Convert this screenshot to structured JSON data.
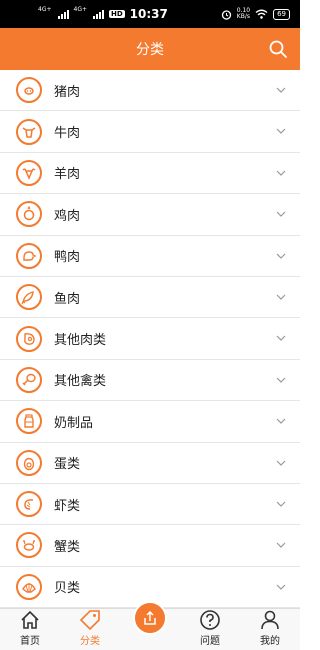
{
  "status_bar": {
    "signal_1": "4G+",
    "signal_2": "4G+",
    "hd": "HD",
    "time": "10:37",
    "net_speed_value": "0.10",
    "net_speed_unit": "KB/s",
    "battery": "69"
  },
  "header": {
    "title": "分类",
    "search_icon": "search-icon"
  },
  "categories": [
    {
      "label": "猪肉",
      "icon": "pig-icon"
    },
    {
      "label": "牛肉",
      "icon": "cow-icon"
    },
    {
      "label": "羊肉",
      "icon": "sheep-icon"
    },
    {
      "label": "鸡肉",
      "icon": "chicken-icon"
    },
    {
      "label": "鸭肉",
      "icon": "duck-icon"
    },
    {
      "label": "鱼肉",
      "icon": "fish-icon"
    },
    {
      "label": "其他肉类",
      "icon": "steak-icon"
    },
    {
      "label": "其他禽类",
      "icon": "drumstick-icon"
    },
    {
      "label": "奶制品",
      "icon": "milk-bottle-icon"
    },
    {
      "label": "蛋类",
      "icon": "egg-icon"
    },
    {
      "label": "虾类",
      "icon": "shrimp-icon"
    },
    {
      "label": "蟹类",
      "icon": "crab-icon"
    },
    {
      "label": "贝类",
      "icon": "shell-icon"
    }
  ],
  "bottom_nav": {
    "items": [
      {
        "label": "首页",
        "icon": "home-icon"
      },
      {
        "label": "分类",
        "icon": "tag-icon",
        "active": true
      },
      {
        "label": "",
        "icon": "share-icon"
      },
      {
        "label": "问题",
        "icon": "question-icon"
      },
      {
        "label": "我的",
        "icon": "user-icon"
      }
    ]
  },
  "colors": {
    "accent": "#f47a2f",
    "divider": "#e6e6e6",
    "text": "#222222"
  }
}
